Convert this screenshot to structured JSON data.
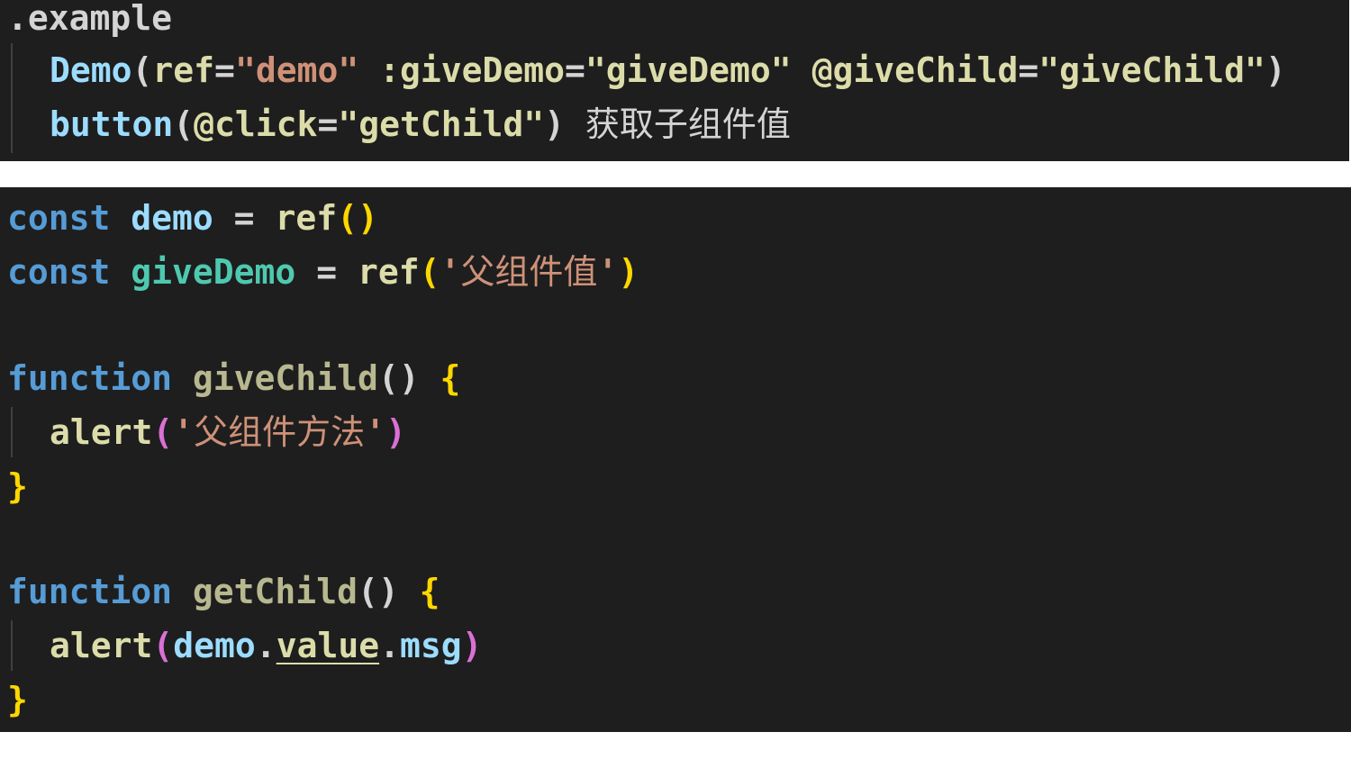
{
  "colors": {
    "background": "#1e1e1e",
    "blue": "#569cd6",
    "lightblue": "#9cdcfe",
    "teal": "#4ec9b0",
    "yellowfn": "#dcdcaa",
    "string": "#ce9178",
    "default": "#d4d4d4",
    "bracket_gold": "#ffd700",
    "bracket_purple": "#da70d6",
    "function_kw": "#569cd6",
    "fname": "#b8b890"
  },
  "top": {
    "line1": ".example",
    "line2": [
      {
        "t": "Demo",
        "c": "lightblue"
      },
      {
        "t": "(",
        "c": "default"
      },
      {
        "t": "ref",
        "c": "yellowfn"
      },
      {
        "t": "=",
        "c": "default"
      },
      {
        "t": "\"demo\"",
        "c": "string"
      },
      {
        "t": " ",
        "c": "default"
      },
      {
        "t": ":giveDemo",
        "c": "yellowfn"
      },
      {
        "t": "=",
        "c": "default"
      },
      {
        "t": "\"giveDemo\"",
        "c": "yellowfn"
      },
      {
        "t": " ",
        "c": "default"
      },
      {
        "t": "@giveChild",
        "c": "yellowfn"
      },
      {
        "t": "=",
        "c": "default"
      },
      {
        "t": "\"giveChild\"",
        "c": "yellowfn"
      },
      {
        "t": ")",
        "c": "default"
      }
    ],
    "line3": [
      {
        "t": "button",
        "c": "lightblue"
      },
      {
        "t": "(",
        "c": "default"
      },
      {
        "t": "@click",
        "c": "yellowfn"
      },
      {
        "t": "=",
        "c": "default"
      },
      {
        "t": "\"getChild\"",
        "c": "yellowfn"
      },
      {
        "t": ") ",
        "c": "default"
      },
      {
        "t": "获取子组件值",
        "c": "default",
        "cjk": true
      }
    ]
  },
  "bottom": {
    "l1": [
      {
        "t": "const",
        "c": "blue"
      },
      {
        "t": " ",
        "c": "default"
      },
      {
        "t": "demo",
        "c": "lightblue"
      },
      {
        "t": " = ",
        "c": "default"
      },
      {
        "t": "ref",
        "c": "yellowfn"
      },
      {
        "t": "()",
        "c": "bracket_gold"
      }
    ],
    "l2": [
      {
        "t": "const",
        "c": "blue"
      },
      {
        "t": " ",
        "c": "default"
      },
      {
        "t": "giveDemo",
        "c": "teal"
      },
      {
        "t": " = ",
        "c": "default"
      },
      {
        "t": "ref",
        "c": "yellowfn"
      },
      {
        "t": "(",
        "c": "bracket_gold"
      },
      {
        "t": "'",
        "c": "string"
      },
      {
        "t": "父组件值",
        "c": "string",
        "cjk": true
      },
      {
        "t": "'",
        "c": "string"
      },
      {
        "t": ")",
        "c": "bracket_gold"
      }
    ],
    "l3": [
      {
        "t": "function",
        "c": "function_kw"
      },
      {
        "t": " ",
        "c": "default"
      },
      {
        "t": "giveChild",
        "c": "fname"
      },
      {
        "t": "() ",
        "c": "default"
      },
      {
        "t": "{",
        "c": "bracket_gold"
      }
    ],
    "l4": [
      {
        "t": "alert",
        "c": "yellowfn"
      },
      {
        "t": "(",
        "c": "bracket_purple"
      },
      {
        "t": "'",
        "c": "string"
      },
      {
        "t": "父组件方法",
        "c": "string",
        "cjk": true
      },
      {
        "t": "'",
        "c": "string"
      },
      {
        "t": ")",
        "c": "bracket_purple"
      }
    ],
    "l5": [
      {
        "t": "}",
        "c": "bracket_gold"
      }
    ],
    "l6": [
      {
        "t": "function",
        "c": "function_kw"
      },
      {
        "t": " ",
        "c": "default"
      },
      {
        "t": "getChild",
        "c": "fname"
      },
      {
        "t": "() ",
        "c": "default"
      },
      {
        "t": "{",
        "c": "bracket_gold"
      }
    ],
    "l7": [
      {
        "t": "alert",
        "c": "yellowfn"
      },
      {
        "t": "(",
        "c": "bracket_purple"
      },
      {
        "t": "demo",
        "c": "lightblue"
      },
      {
        "t": ".",
        "c": "default"
      },
      {
        "t": "value",
        "c": "yellowfn",
        "u": true
      },
      {
        "t": ".",
        "c": "default"
      },
      {
        "t": "msg",
        "c": "lightblue"
      },
      {
        "t": ")",
        "c": "bracket_purple"
      }
    ],
    "l8": [
      {
        "t": "}",
        "c": "bracket_gold"
      }
    ]
  }
}
